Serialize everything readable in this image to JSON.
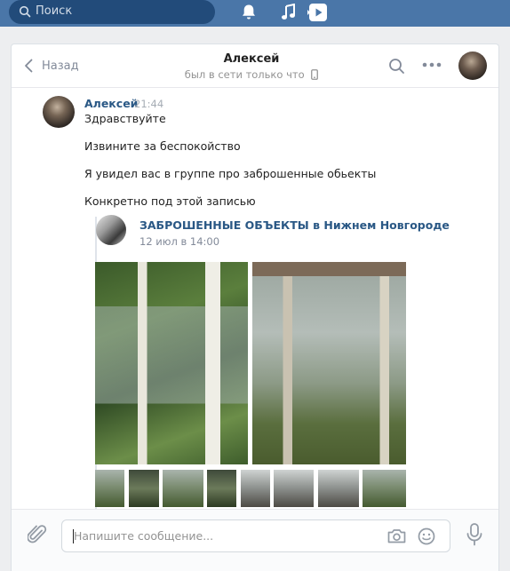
{
  "topbar": {
    "search_placeholder": "Поиск",
    "icons": [
      "search-icon",
      "bell-icon",
      "music-icon",
      "video-icon"
    ]
  },
  "header": {
    "back_label": "Назад",
    "name": "Алексей",
    "status": "был в сети только что",
    "icons": [
      "chevron-left-icon",
      "phone-icon",
      "search-icon",
      "more-icon"
    ]
  },
  "message": {
    "author": "Алексей",
    "time": "21:44",
    "lines": [
      "Здравствуйте",
      "Извините за беспокойство",
      "Я увидел вас в группе про заброшенные обьекты",
      "Конкретно под этой записью"
    ]
  },
  "repost": {
    "group": "ЗАБРОШЕННЫЕ ОБЪЕКТЫ в Нижнем Новгороде",
    "date": "12 июл в 14:00"
  },
  "composer": {
    "placeholder": "Напишите сообщение...",
    "icons": [
      "paperclip-icon",
      "camera-icon",
      "smile-icon",
      "microphone-icon"
    ]
  },
  "colors": {
    "topbar": "#4a76a8",
    "link": "#2a5885",
    "background": "#edeef0"
  }
}
